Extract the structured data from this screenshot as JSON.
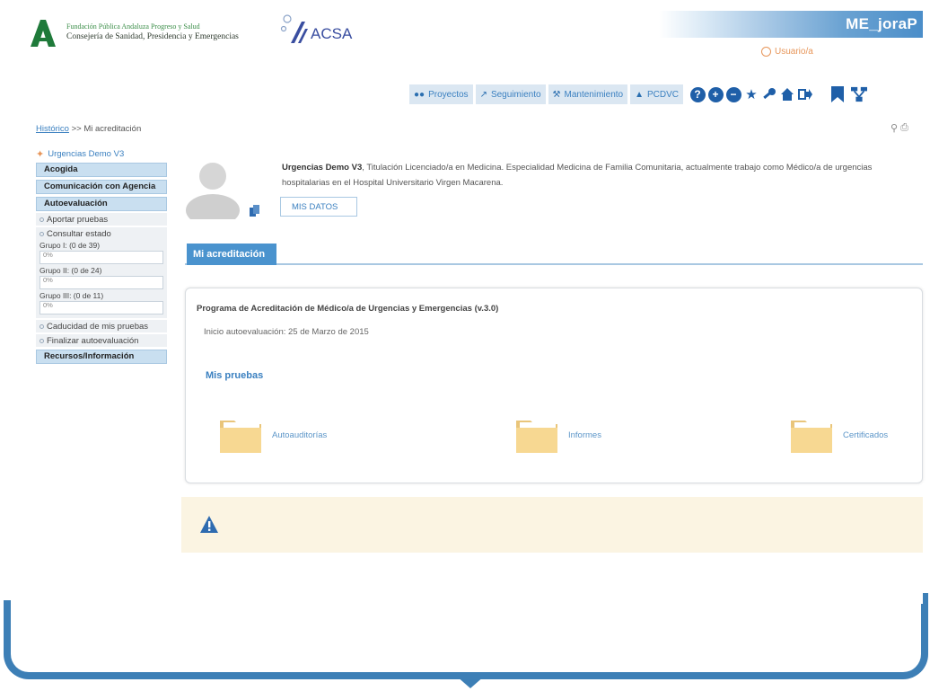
{
  "header": {
    "org_line1": "Fundación Pública Andaluza Progreso y Salud",
    "org_line2": "Consejería de Sanidad, Presidencia y Emergencias",
    "acsa_label": "ACSA",
    "banner_title": "ME_joraP",
    "user_label": "Usuario/a"
  },
  "toolbar": {
    "items": [
      {
        "label": "Proyectos",
        "icon": "users-icon"
      },
      {
        "label": "Seguimiento",
        "icon": "chart-icon"
      },
      {
        "label": "Mantenimiento",
        "icon": "wrench-icon"
      },
      {
        "label": "PCDVC",
        "icon": "graduation-cap-icon"
      }
    ]
  },
  "breadcrumb": {
    "link": "Histórico",
    "separator": ">>",
    "current": "Mi acreditación"
  },
  "sidebar": {
    "title": "Urgencias Demo V3",
    "sections": {
      "acogida": "Acogida",
      "comunicacion": "Comunicación con Agencia",
      "autoevaluacion": "Autoevaluación",
      "recursos": "Recursos/Información"
    },
    "subitems": {
      "aportar": "Aportar pruebas",
      "consultar": "Consultar estado",
      "caducidad": "Caducidad de mis pruebas",
      "finalizar": "Finalizar autoevaluación"
    },
    "groups": [
      {
        "label": "Grupo I: (0 de 39)",
        "progress": "0%"
      },
      {
        "label": "Grupo II: (0 de 24)",
        "progress": "0%"
      },
      {
        "label": "Grupo III: (0 de 11)",
        "progress": "0%"
      }
    ]
  },
  "profile": {
    "name": "Urgencias Demo V3",
    "description": ", Titulación Licenciado/a en Medicina. Especialidad Medicina de Familia Comunitaria, actualmente trabajo como Médico/a de urgencias hospitalarias en el Hospital Universitario Virgen Macarena.",
    "button_label": "MIS DATOS"
  },
  "tab": {
    "label": "Mi acreditación"
  },
  "card": {
    "title": "Programa de Acreditación de Médico/a de Urgencias y Emergencias (v.3.0)",
    "start_date": "Inicio autoevaluación: 25 de Marzo de 2015",
    "subtitle": "Mis pruebas",
    "folders": [
      {
        "label": "Autoauditorías"
      },
      {
        "label": "Informes"
      },
      {
        "label": "Certificados"
      }
    ]
  },
  "colors": {
    "accent": "#3b80c0",
    "tab_blue": "#4a93ce",
    "frame_blue": "#3d7fb6",
    "alert_bg": "#fbf4e2",
    "user_orange": "#e7965a"
  }
}
